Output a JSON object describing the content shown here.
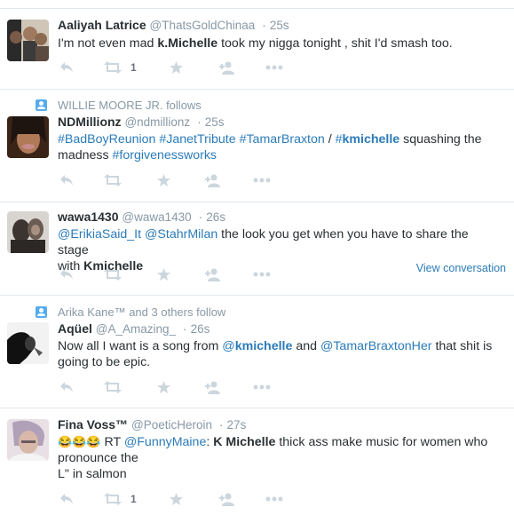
{
  "tweets": [
    {
      "name": "Aaliyah Latrice",
      "handle": "@ThatsGoldChinaa",
      "time": "25s",
      "text_parts": [
        "I'm not even mad ",
        "k.Michelle",
        " took my nigga tonight , shit I'd smash too."
      ],
      "retweet_count": "1",
      "icons": [
        "reply-icon",
        "retweet-icon",
        "favorite-icon",
        "follow-icon",
        "more-icon"
      ]
    },
    {
      "context": "WILLIE MOORE JR. follows",
      "name": "NDMillionz",
      "handle": "@ndmillionz",
      "time": "25s",
      "line1": [
        "#BadBoyReunion",
        "#JanetTribute",
        "#TamarBraxton",
        "/",
        "#",
        "kmichelle",
        " squashing the"
      ],
      "line2": [
        "madness ",
        "#forgivenessworks"
      ]
    },
    {
      "name": "wawa1430",
      "handle": "@wawa1430",
      "time": "26s",
      "line1": [
        "@ErikiaSaid_It",
        "@StahrMilan",
        " the look you get when you have to share the stage"
      ],
      "line2": [
        "with ",
        "Kmichelle"
      ],
      "view_conversation": "View conversation"
    },
    {
      "context": "Arika Kane™ and 3 others follow",
      "name": "Aqüel",
      "handle": "@A_Amazing_",
      "time": "26s",
      "line1": [
        "Now all I want is a song from ",
        "@",
        "kmichelle",
        " and ",
        "@TamarBraxtonHer",
        " that shit is"
      ],
      "line2": "going to be epic."
    },
    {
      "name": "Fina Voss™",
      "handle": "@PoeticHeroin",
      "time": "27s",
      "emoji": "😂😂😂",
      "line1": [
        " RT ",
        "@FunnyMaine",
        ": ",
        "K Michelle",
        " thick ass make music for women who"
      ],
      "line2": "pronounce the",
      "line3": "L\" in salmon",
      "retweet_count": "1"
    }
  ],
  "colors": {
    "link": "#2b7bb9",
    "muted": "#8899a6",
    "icon": "#ccd6dd",
    "divider": "#e1e8ed"
  }
}
